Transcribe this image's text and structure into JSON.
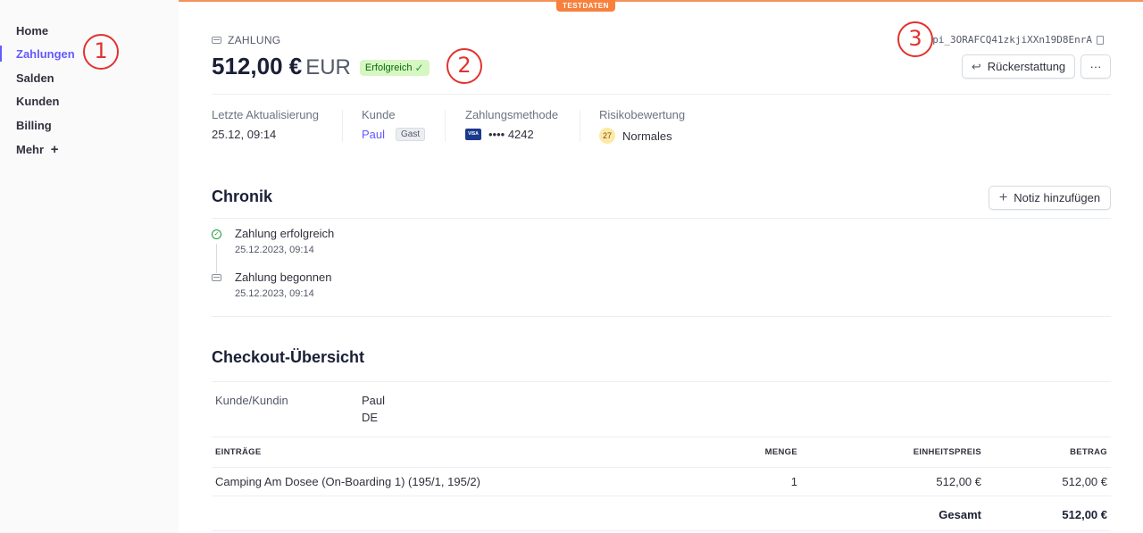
{
  "banner": {
    "label": "TESTDATEN"
  },
  "sidebar": {
    "items": [
      {
        "label": "Home"
      },
      {
        "label": "Zahlungen"
      },
      {
        "label": "Salden"
      },
      {
        "label": "Kunden"
      },
      {
        "label": "Billing"
      },
      {
        "label": "Mehr"
      }
    ],
    "more_icon": "+"
  },
  "annotations": [
    "1",
    "2",
    "3"
  ],
  "header": {
    "kicker": "ZAHLUNG",
    "amount": "512,00 €",
    "currency": "EUR",
    "status": "Erfolgreich",
    "payment_id": "pi_3ORAFCQ41zkjiXXn19D8EnrA",
    "refund_label": "Rückerstattung",
    "more_label": "···"
  },
  "summary": {
    "last_update": {
      "label": "Letzte Aktualisierung",
      "value": "25.12, 09:14"
    },
    "customer": {
      "label": "Kunde",
      "name": "Paul",
      "badge": "Gast"
    },
    "payment_method": {
      "label": "Zahlungsmethode",
      "brand": "VISA",
      "value": "•••• 4242"
    },
    "risk": {
      "label": "Risikobewertung",
      "score": "27",
      "value": "Normales"
    }
  },
  "timeline": {
    "title": "Chronik",
    "add_note_label": "Notiz hinzufügen",
    "events": [
      {
        "title": "Zahlung erfolgreich",
        "date": "25.12.2023, 09:14"
      },
      {
        "title": "Zahlung begonnen",
        "date": "25.12.2023, 09:14"
      }
    ]
  },
  "checkout": {
    "title": "Checkout-Übersicht",
    "customer_label": "Kunde/Kundin",
    "customer_name": "Paul",
    "customer_country": "DE",
    "columns": [
      "EINTRÄGE",
      "MENGE",
      "EINHEITSPREIS",
      "BETRAG"
    ],
    "rows": [
      {
        "item": "Camping Am Dosee (On-Boarding 1) (195/1, 195/2)",
        "qty": "1",
        "unit_price": "512,00 €",
        "amount": "512,00 €"
      }
    ],
    "total_label": "Gesamt",
    "total": "512,00 €"
  },
  "colors": {
    "accent": "#635bff",
    "success": "#1d9b3c",
    "annotation": "#e0332f",
    "test_banner": "#f7803d"
  },
  "icons": {
    "refund": "undo-arrow-icon",
    "add": "plus-icon",
    "copy": "copy-icon",
    "payment": "payment-icon"
  }
}
